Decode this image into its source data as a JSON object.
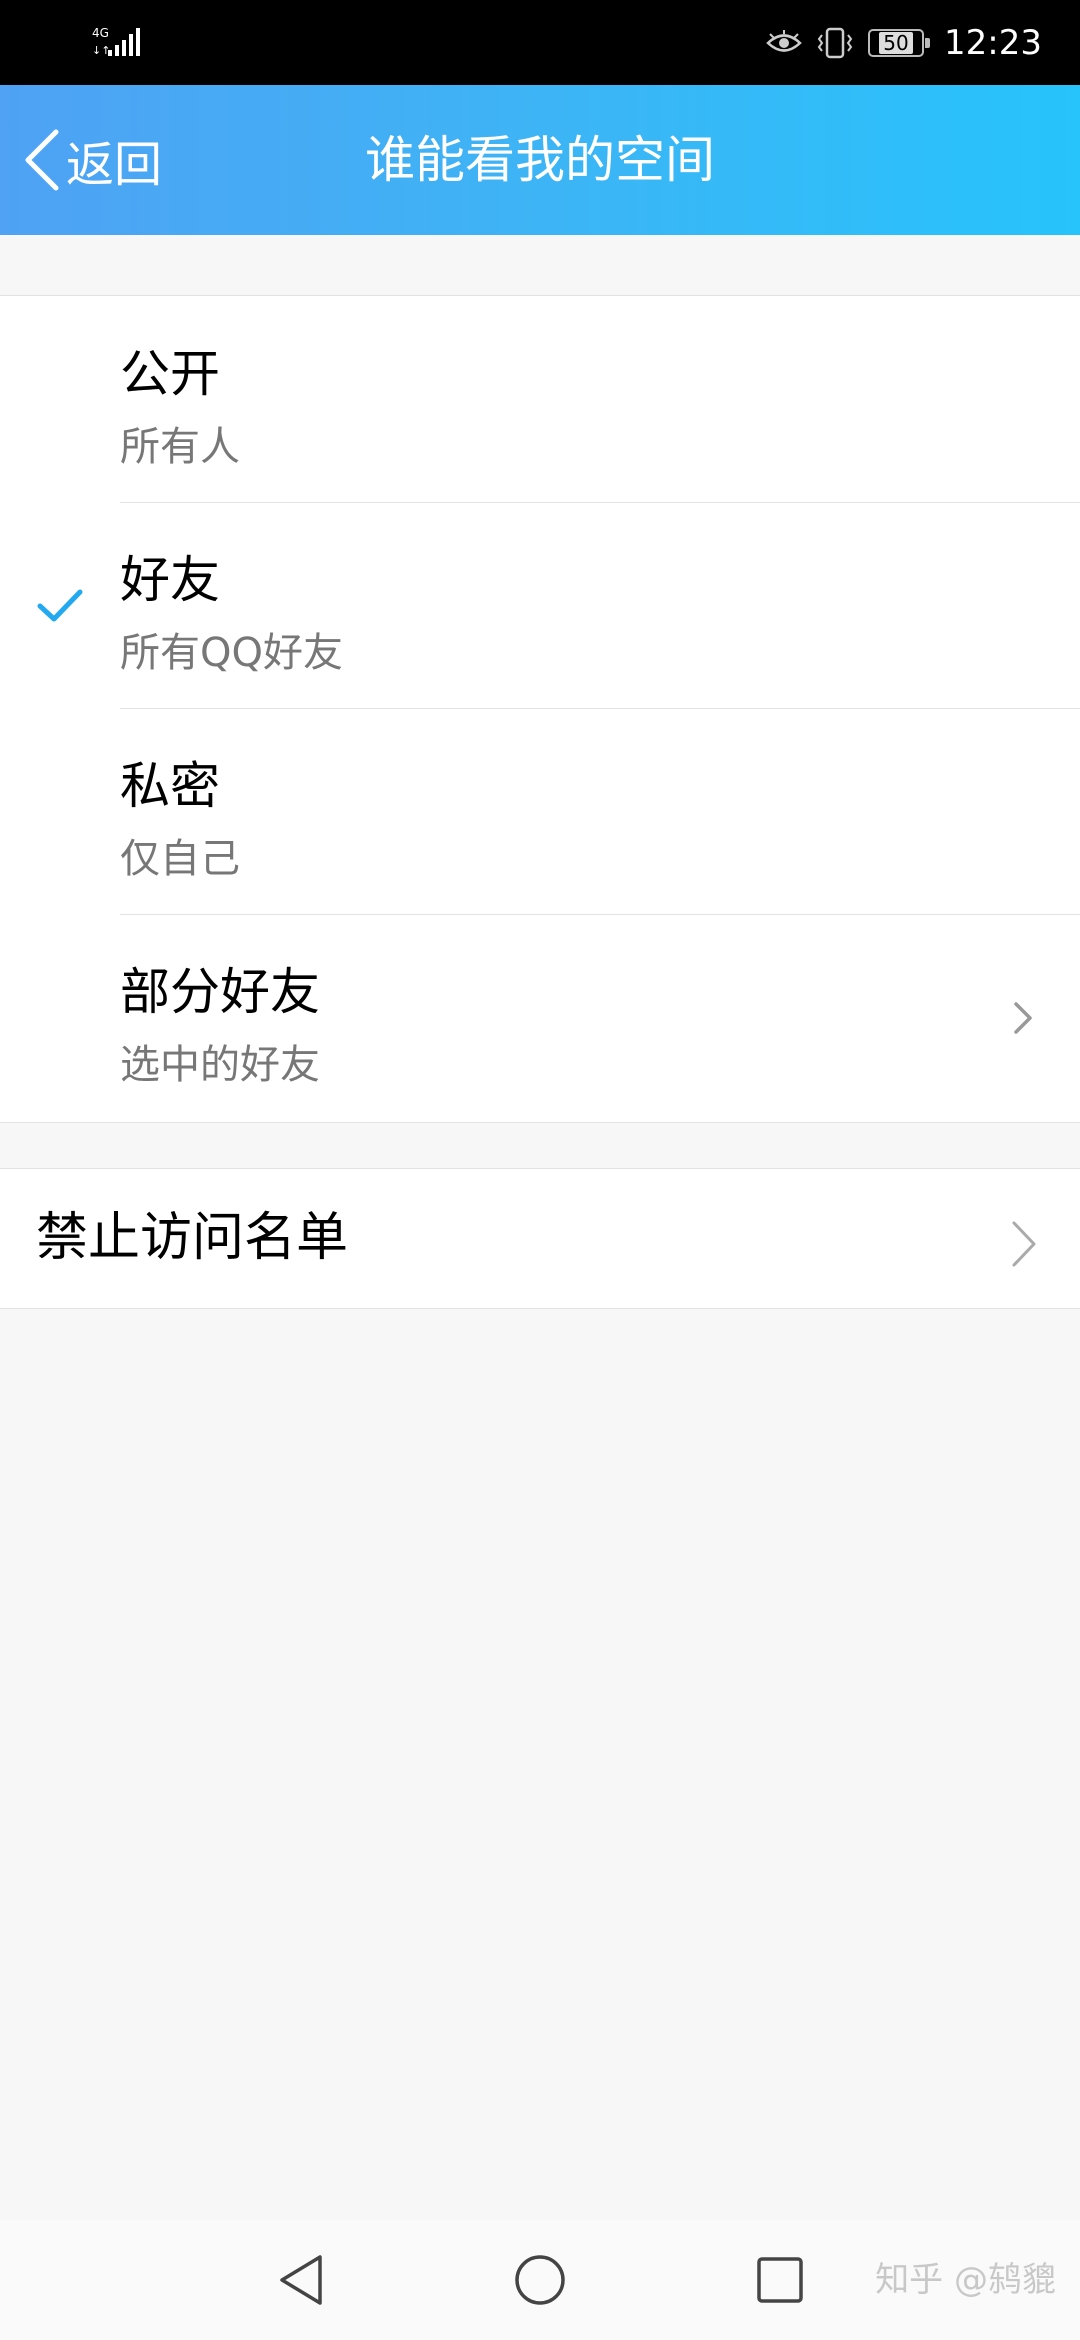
{
  "status_bar": {
    "network": "4G",
    "battery": "50",
    "time": "12:23"
  },
  "header": {
    "back_label": "返回",
    "title": "谁能看我的空间"
  },
  "privacy_options": [
    {
      "title": "公开",
      "subtitle": "所有人",
      "selected": false
    },
    {
      "title": "好友",
      "subtitle": "所有QQ好友",
      "selected": true
    },
    {
      "title": "私密",
      "subtitle": "仅自己",
      "selected": false
    },
    {
      "title": "部分好友",
      "subtitle": "选中的好友",
      "selected": false
    }
  ],
  "block_list": {
    "label": "禁止访问名单"
  },
  "watermark": "知乎 @鸫貔",
  "colors": {
    "header_start": "#4fa2f4",
    "header_end": "#27c3fb",
    "check": "#22a9f0"
  }
}
